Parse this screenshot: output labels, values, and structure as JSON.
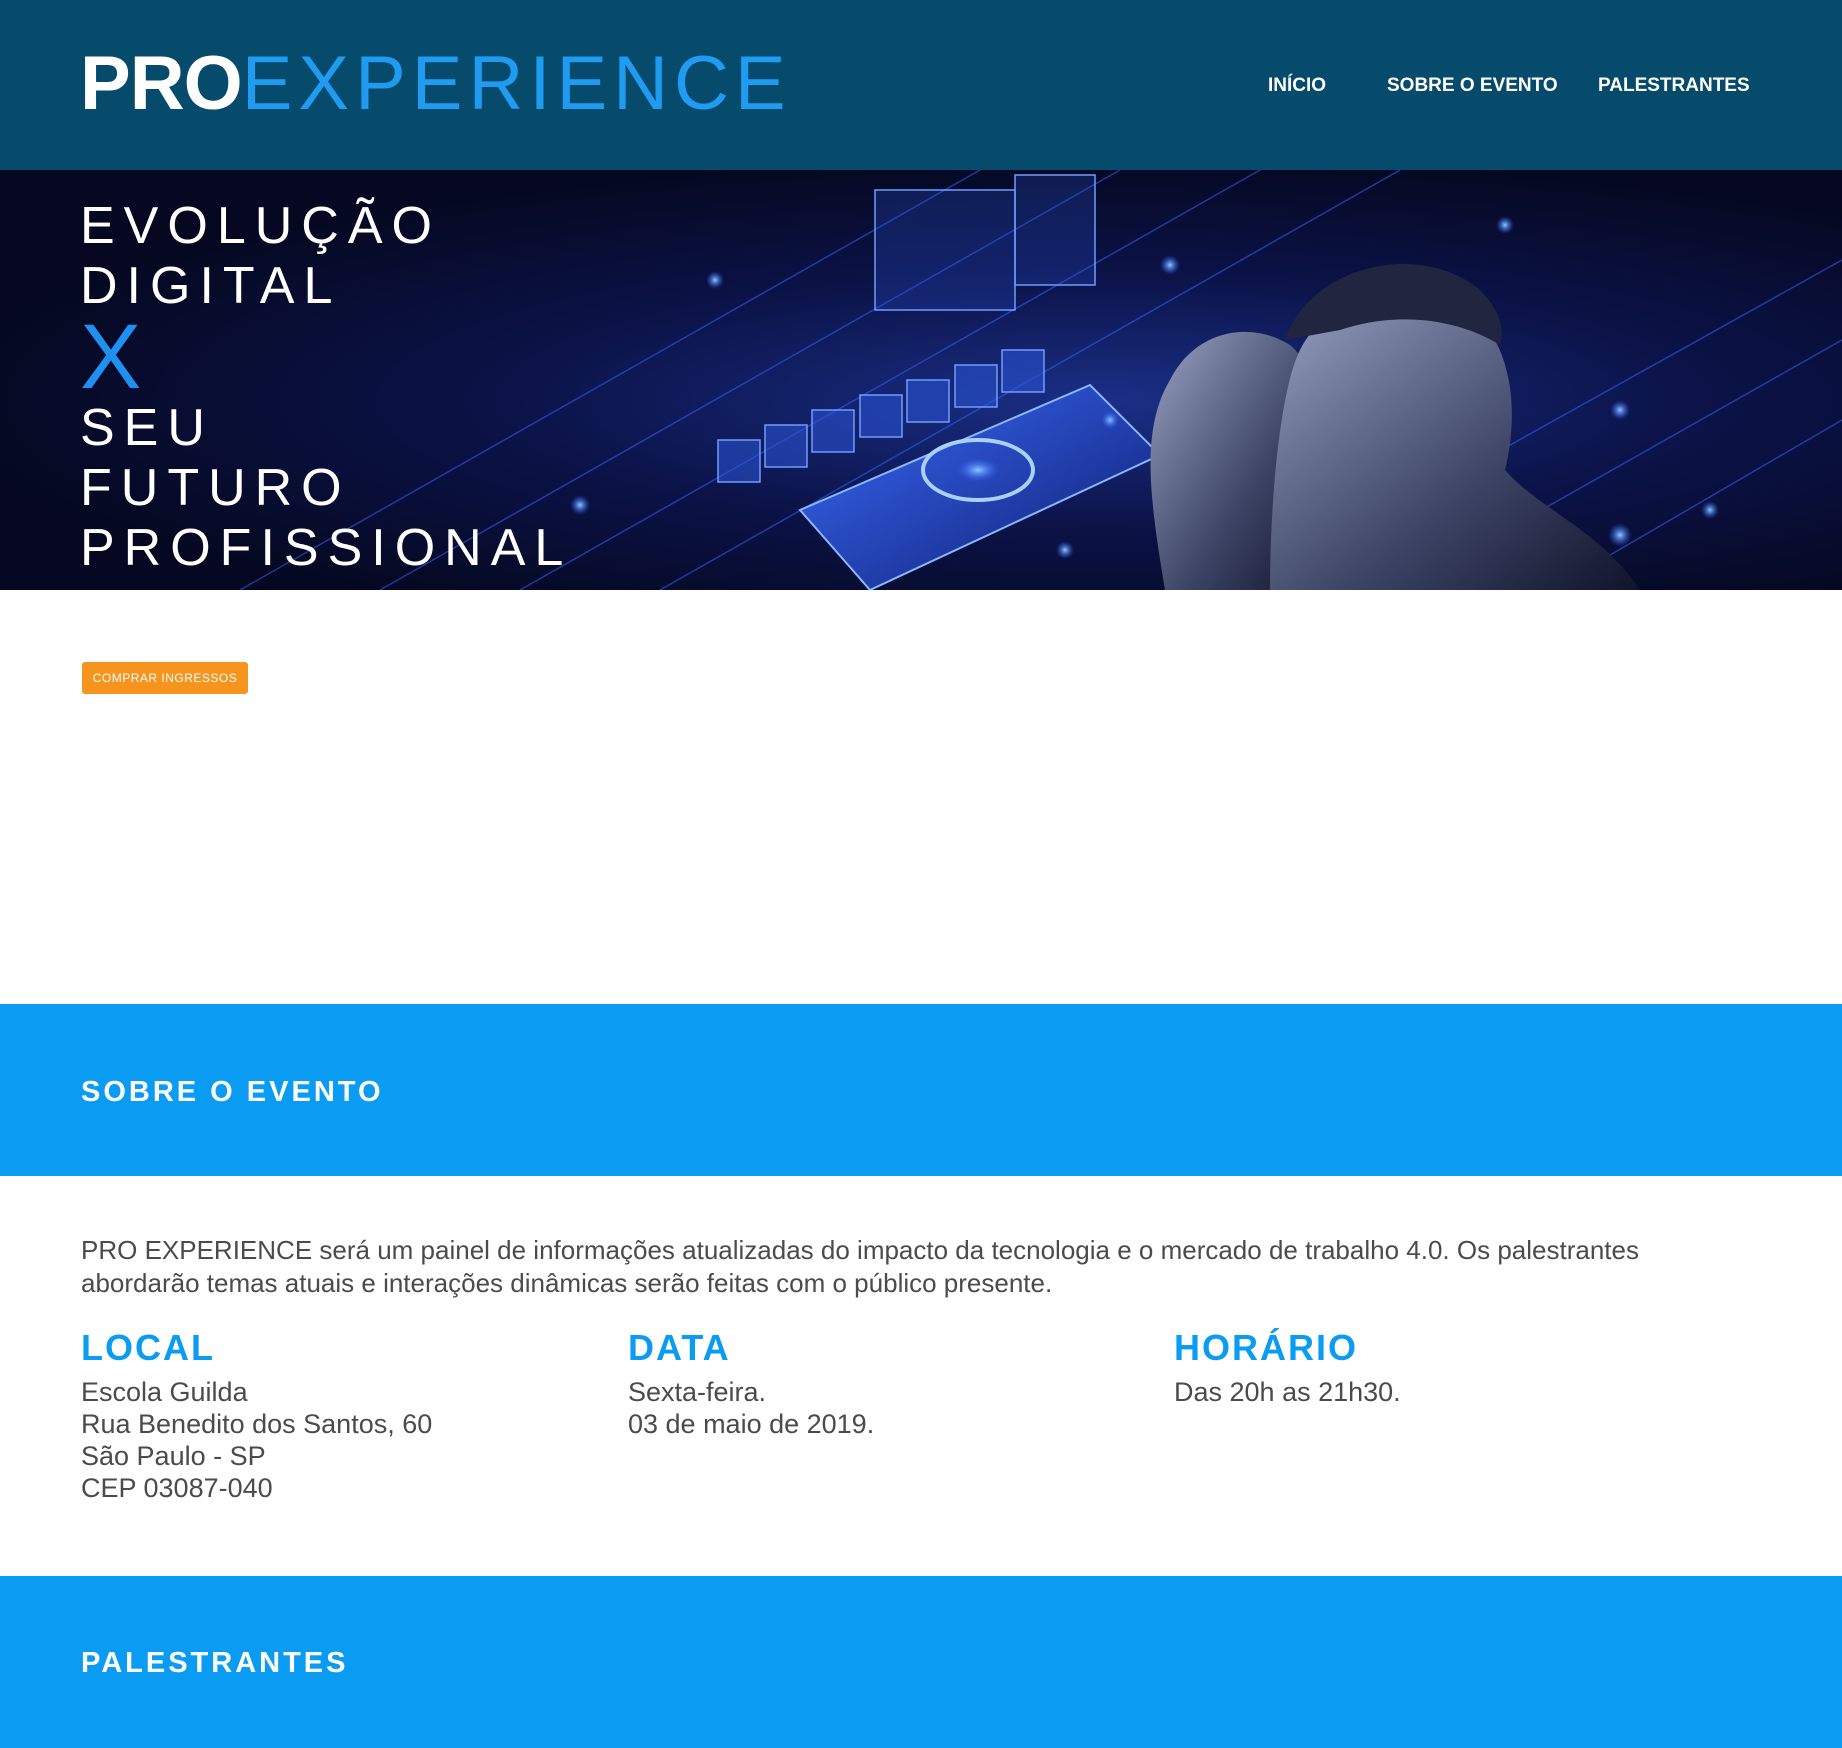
{
  "header": {
    "logo_pro": "PRO",
    "logo_experience": "EXPERIENCE",
    "nav": [
      "INÍCIO",
      "SOBRE O EVENTO",
      "PALESTRANTES"
    ]
  },
  "hero": {
    "lines": [
      "EVOLUÇÃO",
      "DIGITAL",
      "X",
      "SEU",
      "FUTURO",
      "PROFISSIONAL"
    ]
  },
  "buy_button": "COMPRAR INGRESSOS",
  "about": {
    "title": "SOBRE O EVENTO",
    "description": "PRO EXPERIENCE será um painel de informações atualizadas do impacto da tecnologia e o mercado de trabalho 4.0. Os palestrantes abordarão temas atuais e interações dinâmicas serão feitas com o público presente.",
    "local": {
      "heading": "LOCAL",
      "lines": [
        "Escola Guilda",
        "Rua Benedito dos Santos, 60",
        "São Paulo - SP",
        "CEP 03087-040"
      ]
    },
    "data": {
      "heading": "DATA",
      "lines": [
        "Sexta-feira.",
        "03 de maio de 2019."
      ]
    },
    "horario": {
      "heading": "HORÁRIO",
      "lines": [
        "Das 20h as 21h30."
      ]
    }
  },
  "speakers": {
    "title": "PALESTRANTES"
  },
  "colors": {
    "header_bg": "#064b6b",
    "accent_blue": "#0a9cf3",
    "button_orange": "#f7941d",
    "body_text": "#4b4b4b"
  }
}
